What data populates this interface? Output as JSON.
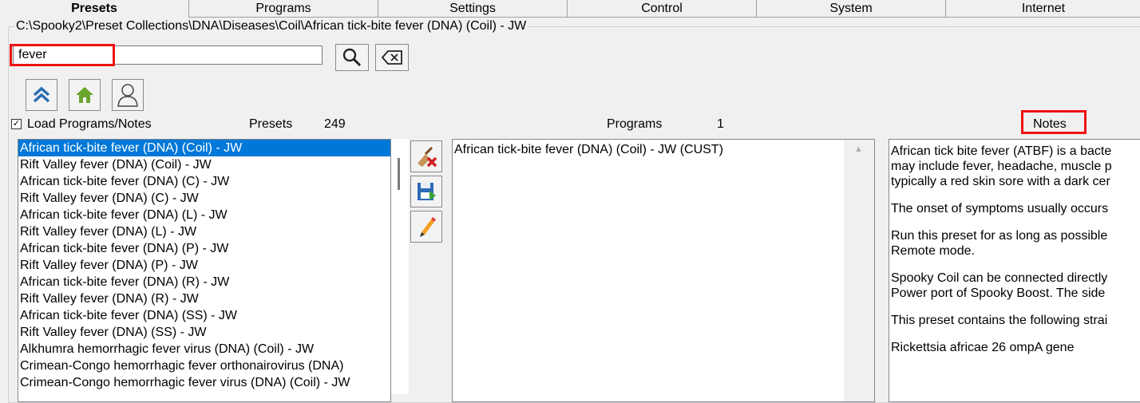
{
  "tabs": [
    "Presets",
    "Programs",
    "Settings",
    "Control",
    "System",
    "Internet"
  ],
  "path": "C:\\Spooky2\\Preset Collections\\DNA\\Diseases\\Coil\\African tick-bite fever (DNA) (Coil) - JW",
  "search": {
    "value": "fever"
  },
  "load_programs": {
    "checked": true,
    "label": "Load Programs/Notes"
  },
  "presets_label": "Presets",
  "presets_count": "249",
  "programs_label": "Programs",
  "programs_count": "1",
  "notes_label": "Notes",
  "presets": [
    "African tick-bite fever (DNA) (Coil) - JW",
    "Rift Valley fever (DNA) (Coil) - JW",
    "African tick-bite fever (DNA) (C) - JW",
    "Rift Valley fever (DNA) (C) - JW",
    "African tick-bite fever (DNA) (L) - JW",
    "Rift Valley fever (DNA) (L) - JW",
    "African tick-bite fever (DNA) (P) - JW",
    "Rift Valley fever (DNA) (P) - JW",
    "African tick-bite fever (DNA) (R) - JW",
    "Rift Valley fever (DNA) (R) - JW",
    "African tick-bite fever (DNA) (SS) - JW",
    "Rift Valley fever (DNA) (SS) - JW",
    "Alkhumra hemorrhagic fever virus (DNA) (Coil) - JW",
    "Crimean-Congo hemorrhagic fever orthonairovirus (DNA)",
    "Crimean-Congo hemorrhagic fever virus (DNA) (Coil) - JW"
  ],
  "selected_preset_index": 0,
  "programs": [
    "African tick-bite fever (DNA) (Coil) - JW (CUST)"
  ],
  "notes": [
    "African tick bite fever (ATBF) is a bacte\nmay include fever, headache, muscle p\ntypically a red skin sore with a dark cer",
    "The onset of symptoms usually occurs",
    "Run this preset for as long as possible\nRemote mode.",
    "Spooky Coil can be connected directly\nPower port of Spooky Boost. The side",
    "This preset contains the following strai",
    "Rickettsia africae 26 ompA gene"
  ],
  "icons": {
    "search": "search-icon",
    "clear": "clear-icon",
    "up": "double-chevron-up-icon",
    "home": "home-icon",
    "user": "user-icon",
    "erase": "erase-icon",
    "save": "save-icon",
    "edit": "edit-pencil-icon"
  },
  "colors": {
    "selection": "#0078d7",
    "highlight": "#e11111",
    "home": "#6aa62c"
  }
}
